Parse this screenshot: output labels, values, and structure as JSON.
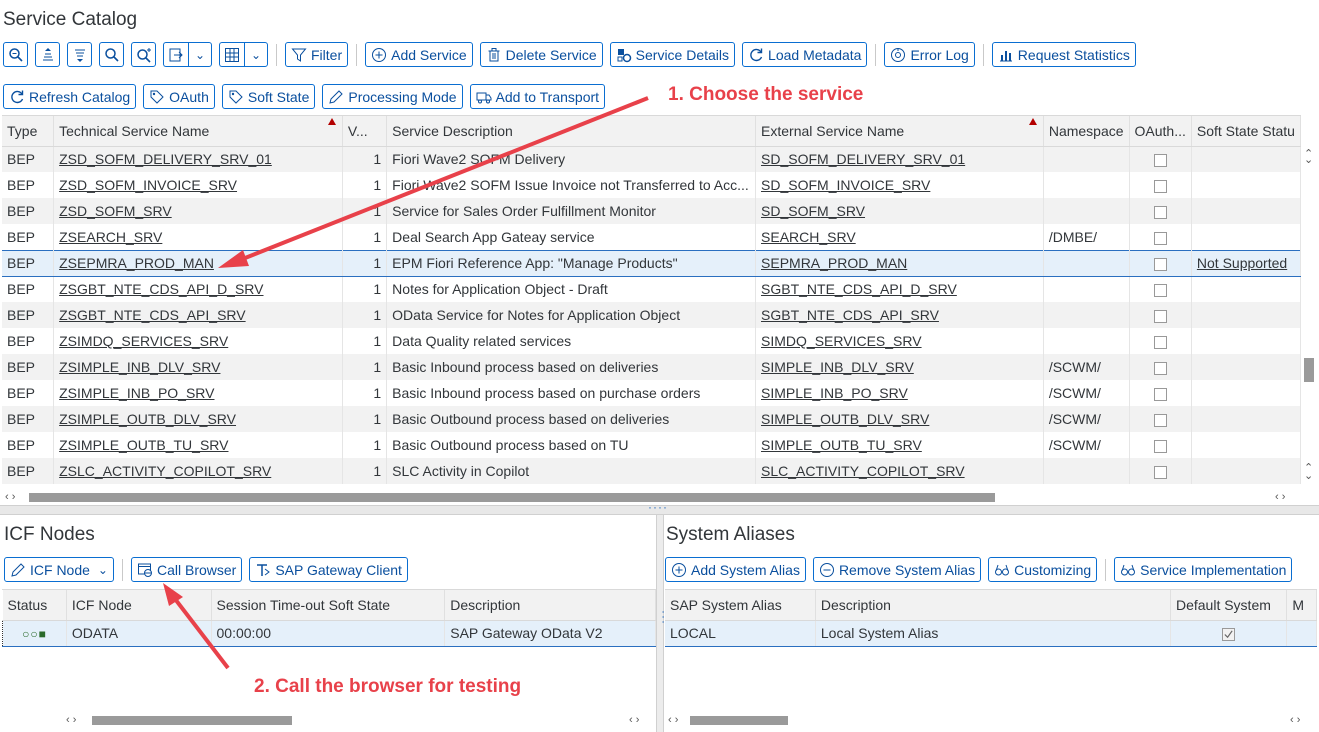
{
  "catalog": {
    "title": "Service Catalog",
    "toolbar1": {
      "filter": "Filter",
      "add_service": "Add Service",
      "delete_service": "Delete Service",
      "service_details": "Service Details",
      "load_metadata": "Load Metadata",
      "error_log": "Error Log",
      "request_statistics": "Request Statistics"
    },
    "toolbar2": {
      "refresh_catalog": "Refresh Catalog",
      "oauth": "OAuth",
      "soft_state": "Soft State",
      "processing_mode": "Processing Mode",
      "add_to_transport": "Add to Transport"
    },
    "columns": [
      "Type",
      "Technical Service Name",
      "V...",
      "Service Description",
      "External Service Name",
      "Namespace",
      "OAuth...",
      "Soft State Statu"
    ],
    "rows": [
      {
        "type": "BEP",
        "tech": "ZSD_SOFM_DELIVERY_SRV_01",
        "v": "1",
        "desc": "Fiori Wave2 SOFM Delivery",
        "ext": "SD_SOFM_DELIVERY_SRV_01",
        "ns": "",
        "soft": ""
      },
      {
        "type": "BEP",
        "tech": "ZSD_SOFM_INVOICE_SRV",
        "v": "1",
        "desc": "Fiori Wave2 SOFM Issue Invoice not Transferred to Acc...",
        "ext": "SD_SOFM_INVOICE_SRV",
        "ns": "",
        "soft": ""
      },
      {
        "type": "BEP",
        "tech": "ZSD_SOFM_SRV",
        "v": "1",
        "desc": "Service for Sales Order Fulfillment Monitor",
        "ext": "SD_SOFM_SRV",
        "ns": "",
        "soft": ""
      },
      {
        "type": "BEP",
        "tech": "ZSEARCH_SRV",
        "v": "1",
        "desc": "Deal Search App Gateay service",
        "ext": "SEARCH_SRV",
        "ns": "/DMBE/",
        "soft": ""
      },
      {
        "type": "BEP",
        "tech": "ZSEPMRA_PROD_MAN",
        "v": "1",
        "desc": "EPM Fiori Reference App: \"Manage Products\"",
        "ext": "SEPMRA_PROD_MAN",
        "ns": "",
        "soft": "Not Supported"
      },
      {
        "type": "BEP",
        "tech": "ZSGBT_NTE_CDS_API_D_SRV",
        "v": "1",
        "desc": "Notes for Application Object - Draft",
        "ext": "SGBT_NTE_CDS_API_D_SRV",
        "ns": "",
        "soft": ""
      },
      {
        "type": "BEP",
        "tech": "ZSGBT_NTE_CDS_API_SRV",
        "v": "1",
        "desc": "OData Service for Notes for Application Object",
        "ext": "SGBT_NTE_CDS_API_SRV",
        "ns": "",
        "soft": ""
      },
      {
        "type": "BEP",
        "tech": "ZSIMDQ_SERVICES_SRV",
        "v": "1",
        "desc": "Data Quality related services",
        "ext": "SIMDQ_SERVICES_SRV",
        "ns": "",
        "soft": ""
      },
      {
        "type": "BEP",
        "tech": "ZSIMPLE_INB_DLV_SRV",
        "v": "1",
        "desc": "Basic Inbound process based on deliveries",
        "ext": "SIMPLE_INB_DLV_SRV",
        "ns": "/SCWM/",
        "soft": ""
      },
      {
        "type": "BEP",
        "tech": "ZSIMPLE_INB_PO_SRV",
        "v": "1",
        "desc": "Basic Inbound process based on purchase orders",
        "ext": "SIMPLE_INB_PO_SRV",
        "ns": "/SCWM/",
        "soft": ""
      },
      {
        "type": "BEP",
        "tech": "ZSIMPLE_OUTB_DLV_SRV",
        "v": "1",
        "desc": "Basic Outbound process based on deliveries",
        "ext": "SIMPLE_OUTB_DLV_SRV",
        "ns": "/SCWM/",
        "soft": ""
      },
      {
        "type": "BEP",
        "tech": "ZSIMPLE_OUTB_TU_SRV",
        "v": "1",
        "desc": "Basic Outbound process based on TU",
        "ext": "SIMPLE_OUTB_TU_SRV",
        "ns": "/SCWM/",
        "soft": ""
      },
      {
        "type": "BEP",
        "tech": "ZSLC_ACTIVITY_COPILOT_SRV",
        "v": "1",
        "desc": "SLC Activity in Copilot",
        "ext": "SLC_ACTIVITY_COPILOT_SRV",
        "ns": "",
        "soft": ""
      }
    ]
  },
  "icf": {
    "title": "ICF Nodes",
    "toolbar": {
      "icf_node": "ICF Node",
      "call_browser": "Call Browser",
      "gateway_client": "SAP Gateway Client"
    },
    "columns": [
      "Status",
      "ICF Node",
      "Session Time-out Soft State",
      "Description"
    ],
    "rows": [
      {
        "status": "○○■",
        "node": "ODATA",
        "timeout": "00:00:00",
        "desc": "SAP Gateway OData V2"
      }
    ]
  },
  "aliases": {
    "title": "System Aliases",
    "toolbar": {
      "add": "Add System Alias",
      "remove": "Remove System Alias",
      "customizing": "Customizing",
      "impl": "Service Implementation"
    },
    "columns": [
      "SAP System Alias",
      "Description",
      "Default System",
      "M"
    ],
    "rows": [
      {
        "alias": "LOCAL",
        "desc": "Local System Alias"
      }
    ]
  },
  "annotations": {
    "step1": "1. Choose the service",
    "step2": "2. Call the browser for testing"
  },
  "colors": {
    "accent": "#0a6ed1",
    "annotation": "#e8414a",
    "selection": "#e5f0fa"
  }
}
